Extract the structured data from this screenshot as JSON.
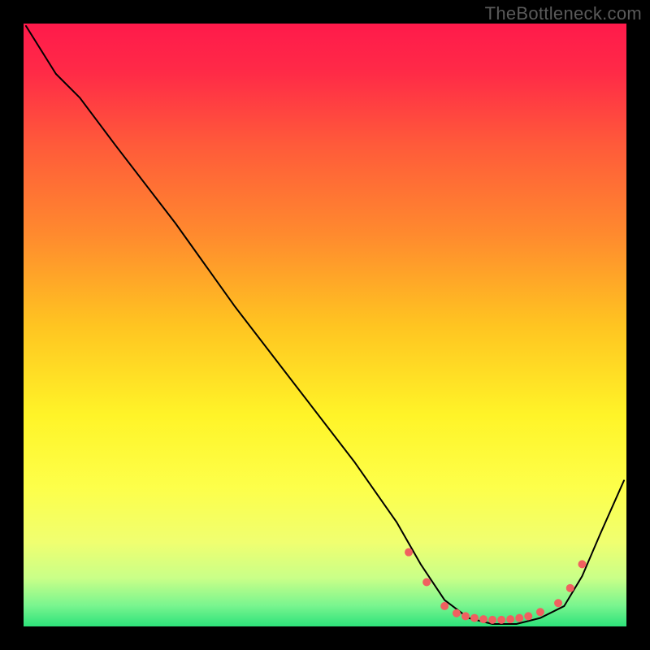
{
  "watermark": "TheBottleneck.com",
  "chart_data": {
    "type": "line",
    "title": "",
    "xlabel": "",
    "ylabel": "",
    "xlim": [
      0,
      100
    ],
    "ylim": [
      0,
      100
    ],
    "grid": false,
    "axes_visible": false,
    "legend": false,
    "background_gradient_stops": [
      {
        "pos": 0.0,
        "color": "#ff1a4b"
      },
      {
        "pos": 0.08,
        "color": "#ff2a47"
      },
      {
        "pos": 0.2,
        "color": "#ff5a3a"
      },
      {
        "pos": 0.35,
        "color": "#ff8a2e"
      },
      {
        "pos": 0.5,
        "color": "#ffc421"
      },
      {
        "pos": 0.65,
        "color": "#fff428"
      },
      {
        "pos": 0.77,
        "color": "#fdff4a"
      },
      {
        "pos": 0.86,
        "color": "#f0ff70"
      },
      {
        "pos": 0.92,
        "color": "#c9ff88"
      },
      {
        "pos": 0.965,
        "color": "#7af58f"
      },
      {
        "pos": 1.0,
        "color": "#2de27a"
      }
    ],
    "series": [
      {
        "name": "bottleneck-curve",
        "color": "#000000",
        "stroke_width": 2,
        "x": [
          0,
          5,
          9,
          15,
          25,
          35,
          45,
          55,
          62,
          66,
          70,
          74,
          78,
          82,
          86,
          90,
          93,
          96,
          100
        ],
        "y": [
          100,
          92,
          88,
          80,
          67,
          53,
          40,
          27,
          17,
          10,
          4,
          1,
          0,
          0,
          1,
          3,
          8,
          15,
          24
        ]
      }
    ],
    "markers": {
      "name": "flat-zone-dots",
      "color": "#f06060",
      "radius": 5,
      "x": [
        64,
        67,
        70,
        72,
        73.5,
        75,
        76.5,
        78,
        79.5,
        81,
        82.5,
        84,
        86,
        89,
        91,
        93
      ],
      "y": [
        12,
        7,
        3,
        1.8,
        1.3,
        1.0,
        0.8,
        0.7,
        0.7,
        0.8,
        1.0,
        1.3,
        2.0,
        3.5,
        6,
        10
      ]
    }
  }
}
